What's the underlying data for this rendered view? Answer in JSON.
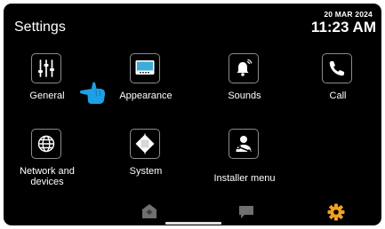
{
  "header": {
    "title": "Settings",
    "date": "20 MAR 2024",
    "time": "11:23 AM"
  },
  "tiles": [
    {
      "label": "General",
      "icon": "sliders-icon"
    },
    {
      "label": "Appearance",
      "icon": "monitor-icon"
    },
    {
      "label": "Sounds",
      "icon": "bell-icon"
    },
    {
      "label": "Call",
      "icon": "phone-icon"
    },
    {
      "label": "Network and devices",
      "icon": "globe-icon"
    },
    {
      "label": "System",
      "icon": "chip-icon"
    },
    {
      "label": "Installer menu",
      "icon": "installer-icon"
    }
  ],
  "bottom_nav": [
    {
      "icon": "home-icon",
      "color": "#707070"
    },
    {
      "icon": "message-icon",
      "color": "#707070"
    },
    {
      "icon": "settings-gear-icon",
      "color": "#f0a020"
    }
  ],
  "colors": {
    "background": "#000000",
    "accent": "#f0a020",
    "pointer": "#1ea0e6",
    "monitor_screen": "#3aaed8"
  }
}
